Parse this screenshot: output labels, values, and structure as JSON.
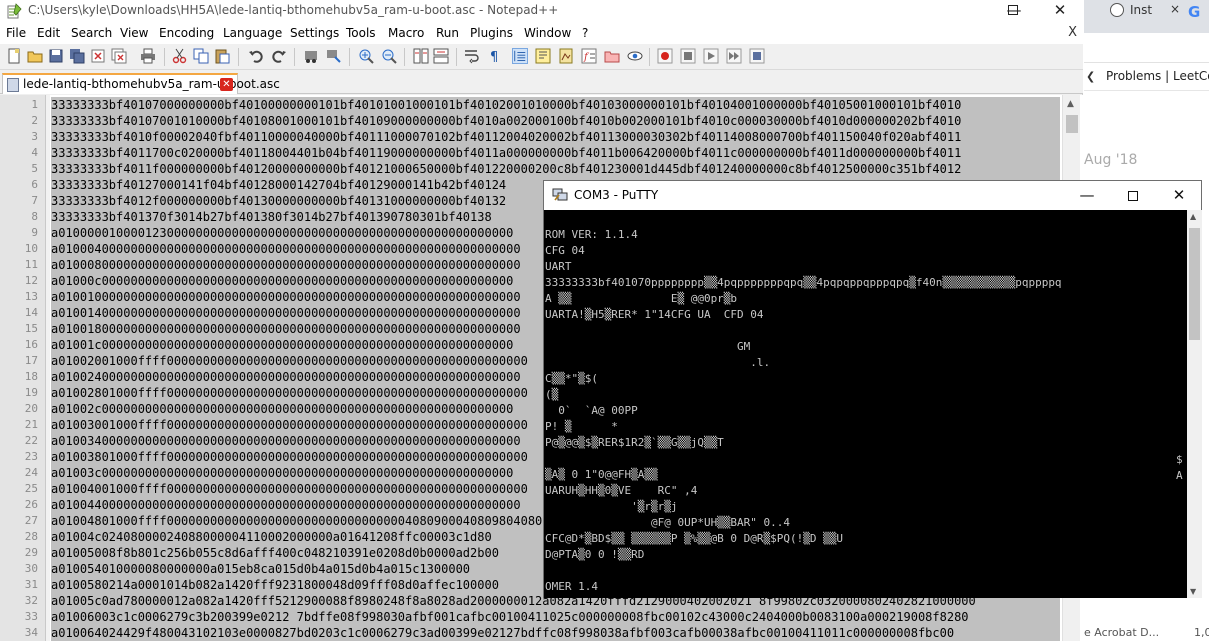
{
  "notepad": {
    "title": "C:\\Users\\kyle\\Downloads\\HH5A\\lede-lantiq-bthomehubv5a_ram-u-boot.asc - Notepad++",
    "menu": [
      "File",
      "Edit",
      "Search",
      "View",
      "Encoding",
      "Language",
      "Settings",
      "Tools",
      "Macro",
      "Run",
      "Plugins",
      "Window",
      "?"
    ],
    "menu_close": "X",
    "tab_label": "lede-lantiq-bthomehubv5a_ram-u-boot.asc",
    "line_numbers": [
      "1",
      "2",
      "3",
      "4",
      "5",
      "6",
      "7",
      "8",
      "9",
      "10",
      "11",
      "12",
      "13",
      "14",
      "15",
      "16",
      "17",
      "18",
      "19",
      "20",
      "21",
      "22",
      "23",
      "24",
      "25",
      "26",
      "27",
      "28",
      "29",
      "30",
      "31",
      "32",
      "33",
      "34"
    ],
    "lines": [
      "33333333bf40107000000000bf40100000000101bf40101001000101bf40102001010000bf40103000000101bf40104001000000bf40105001000101bf4010",
      "33333333bf40107001010000bf40108001000101bf40109000000000bf4010a002000100bf4010b002000101bf4010c000030000bf4010d000000202bf4010",
      "33333333bf4010f00002040fbf40110000040000bf40111000070102bf40112004020002bf40113000030302bf40114008000700bf401150040f020abf4011",
      "33333333bf4011700c020000bf40118004401b04bf40119000000000bf4011a000000000bf4011b006420000bf4011c000000000bf4011d000000000bf4011",
      "33333333bf4011f000000000bf40120000000000bf40121000650000bf401220000200c8bf401230001d445dbf401240000000c8bf4012500000c351bf4012",
      "33333333bf40127000141f04bf40128000142704bf40129000141b42bf40124",
      "33333333bf4012f000000000bf40130000000000bf40131000000000bf40132",
      "33333333bf401370f3014b27bf401380f3014b27bf401390780301bf40138",
      "a010000010000123000000000000000000000000000000000000000000000000",
      "a0100040000000000000000000000000000000000000000000000000000000000",
      "a0100080000000000000000000000000000000000000000000000000000000000",
      "a01000c000000000000000000000000000000000000000000000000000000000",
      "a0100100000000000000000000000000000000000000000000000000000000000",
      "a0100140000000000000000000000000000000000000000000000000000000000",
      "a0100180000000000000000000000000000000000000000000000000000000000",
      "a01001c000000000000000000000000000000000000000000000000000000000",
      "a01002001000ffff00000000000000000000000000000000000000000000000000",
      "a0100240000000000000000000000000000000000000000000000000000000000",
      "a01002801000ffff00000000000000000000000000000000000000000000000000",
      "a01002c000000000000000000000000000000000000000000000000000000000",
      "a01003001000ffff00000000000000000000000000000000000000000000000000",
      "a0100340000000000000000000000000000000000000000000000000000000000",
      "a01003801000ffff00000000000000000000000000000000000000000000000000",
      "a01003c000000000000000000000000000000000000000000000000000000000",
      "a01004001000ffff00000000000000000000000000000000000000000000000000",
      "a0100440000000000000000000000000000000000000000000000000000000000",
      "a01004801000ffff000000000000000000000000000000000408090004080980408068",
      "a01004c02408000024088000004110002000000a01641208ffc00003c1d80",
      "a01005008f8b801c256b055c8d6afff400c048210391e0208d0b0000ad2b00",
      "a010054010000080000000a015eb8ca015d0b4a015d0b4a015c1300000",
      "a0100580214a0001014b082a1420fff9231800048d09fff08d0affec100000",
      "a01005c0ad780000012a082a1420fff5212900088f8980248f8a8028ad2000000012a082a1420fffd2129000402002021 8f99802c0320000802402821000000",
      "a01006003c1c0006279c3b200399e0212 7bdffe08f998030afbf001cafbc00100411025c000000008fbc00102c43000c2404000b0083100a000219008f8280",
      "a010064024429f480043102103e0000827bd0203c1c0006279c3ad00399e02127bdffc08f998038afbf003cafb00038afbc00100411011c000000008fbc00"
    ]
  },
  "browser": {
    "tab1_label": "Inst",
    "tab1_close": "×",
    "tab2_label": "G",
    "bookmark_label": "Problems | LeetCod",
    "date_text": "Aug '18",
    "bottom_left": "e Acrobat D...",
    "bottom_right": "1,0"
  },
  "putty": {
    "title": "COM3 - PuTTY",
    "terminal_lines": [
      "",
      "ROM VER: 1.1.4",
      "CFG 04",
      "UART",
      "33333333bf401070pppppppp▒▒4pqpppppppqpq▒▒4pqpqppqpppqpq▒f40n▒▒▒▒▒▒▒▒▒▒▒pqppppq",
      "A ▒▒               E▒ @@0pr▒b",
      "UARTA!▒H5▒RER* 1\"14CFG UA  CFD 04",
      "",
      "                             GM",
      "                               .l.",
      "C▒▒*\"▒$(",
      "(▒",
      "  0`  `A@ 00PP",
      "P! ▒      *",
      "P@▒@@▒$▒RER$1R2▒`▒▒G▒▒jQ▒▒T",
      "",
      "▒A▒ 0 1\"0@@FH▒A▒▒",
      "UARUH▒HH▒0▒VE    RC\" ,4",
      "             '▒r▒r▒j",
      "                @F@ 0UP*UH▒▒BAR\" 0..4",
      "CFC@D*▒BD$▒▒ ▒▒▒▒▒▒P ▒%▒▒@B 0 D@R▒$PQ(!▒D ▒▒U",
      "D@PTA▒0 0 !▒▒RD",
      "",
      "OMER 1.4"
    ],
    "right_mark_1": "$",
    "right_mark_2": "A"
  }
}
